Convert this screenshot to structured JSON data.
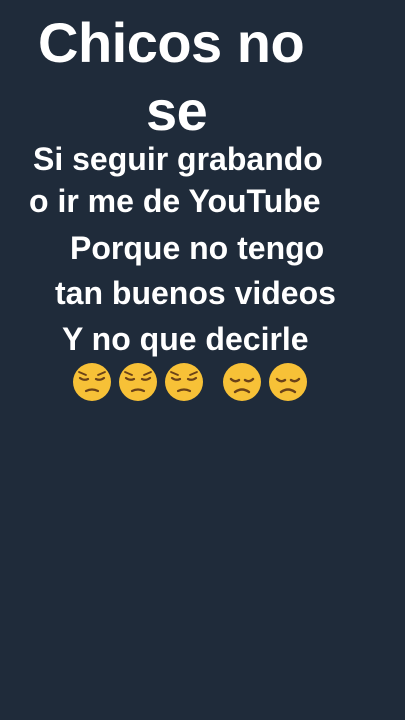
{
  "title": {
    "line1": "Chicos no",
    "line2": "se"
  },
  "message": {
    "lines": [
      "Si seguir grabando",
      "o ir me de YouTube",
      "Porque no tengo",
      "tan buenos videos",
      "Y no que decirle"
    ]
  },
  "emojis": [
    {
      "icon": "pensive-face-icon"
    },
    {
      "icon": "pensive-face-icon"
    },
    {
      "icon": "pensive-face-icon"
    },
    {
      "icon": "disappointed-face-icon"
    },
    {
      "icon": "disappointed-face-icon"
    }
  ],
  "colors": {
    "background": "#1f2b3a",
    "text": "#ffffff",
    "emoji_face": "#f7c137",
    "emoji_feature": "#6b4218"
  }
}
